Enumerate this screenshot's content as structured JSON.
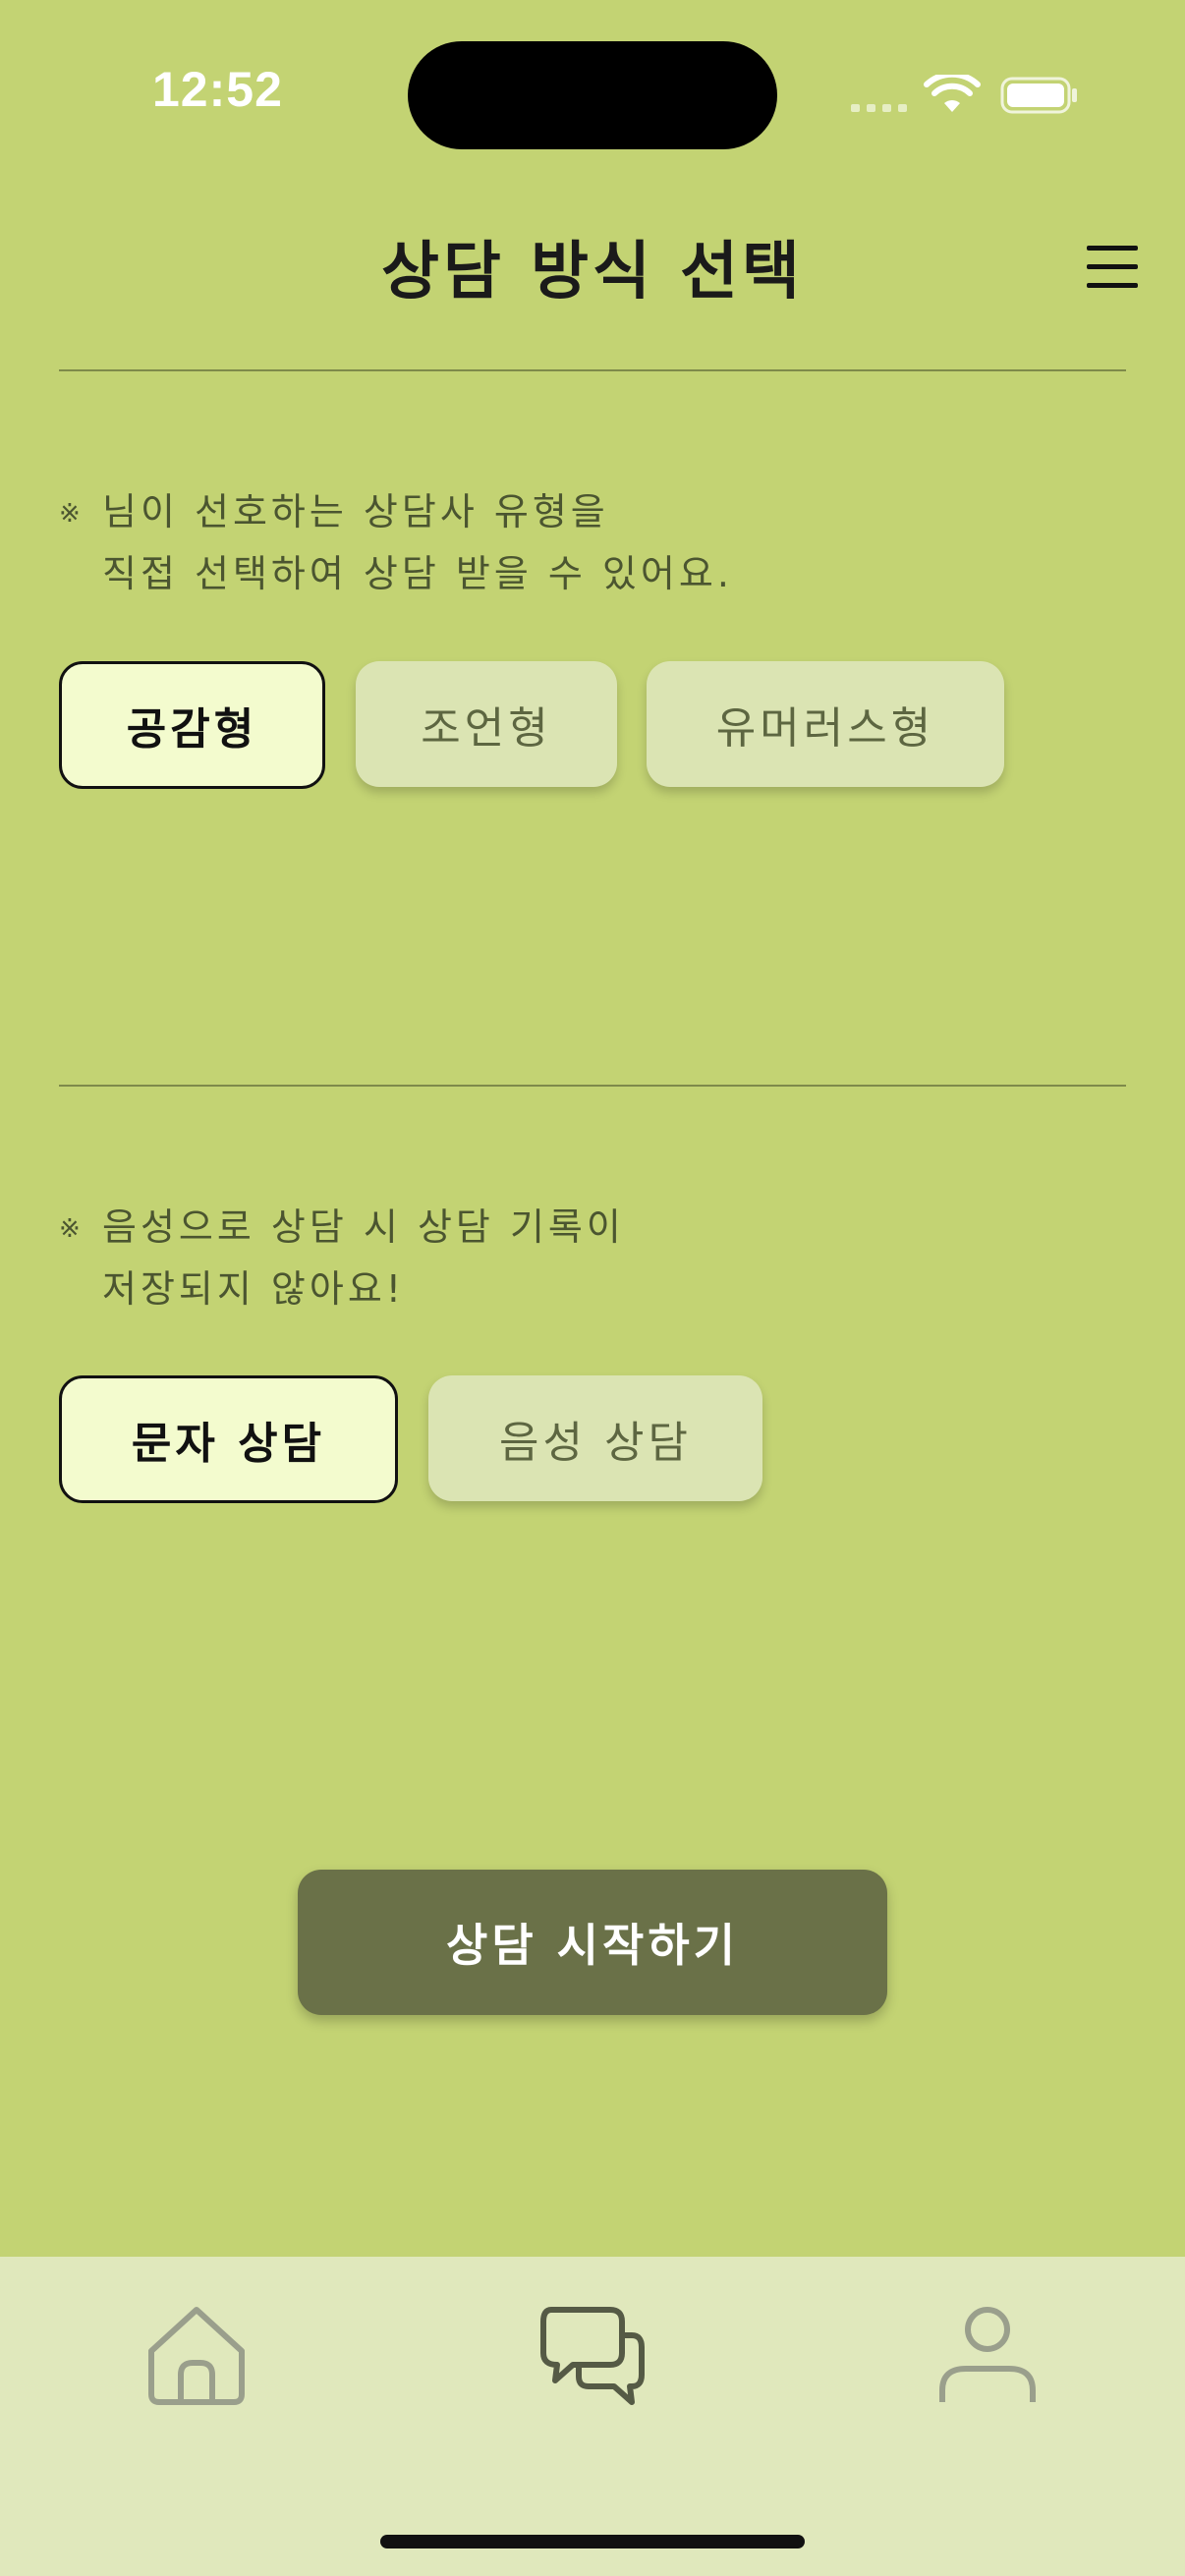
{
  "status_bar": {
    "time": "12:52",
    "icons": [
      "cellular-signal-icon",
      "wifi-icon",
      "battery-icon"
    ]
  },
  "header": {
    "title": "상담 방식 선택",
    "menu_icon": "hamburger-menu-icon"
  },
  "counselor_type": {
    "note_mark": "※",
    "note_line1": "님이 선호하는 상담사 유형을",
    "note_line2": "직접 선택하여 상담 받을 수 있어요.",
    "options": [
      {
        "label": "공감형",
        "selected": true
      },
      {
        "label": "조언형",
        "selected": false
      },
      {
        "label": "유머러스형",
        "selected": false
      }
    ]
  },
  "counsel_mode": {
    "note_mark": "※",
    "note_line1": "음성으로 상담 시 상담 기록이",
    "note_line2": "저장되지 않아요!",
    "options": [
      {
        "label": "문자 상담",
        "selected": true
      },
      {
        "label": "음성 상담",
        "selected": false
      }
    ]
  },
  "start_button": {
    "label": "상담 시작하기"
  },
  "tab_bar": {
    "tabs": [
      {
        "icon": "home-icon",
        "active": false
      },
      {
        "icon": "chat-bubbles-icon",
        "active": true
      },
      {
        "icon": "profile-icon",
        "active": false
      }
    ]
  },
  "colors": {
    "background": "#c3d373",
    "selected_option": "#f3fbce",
    "unselected_option": "#dbe4b3",
    "primary_button": "#6a7148",
    "tab_bar": "#e0e8bc"
  }
}
